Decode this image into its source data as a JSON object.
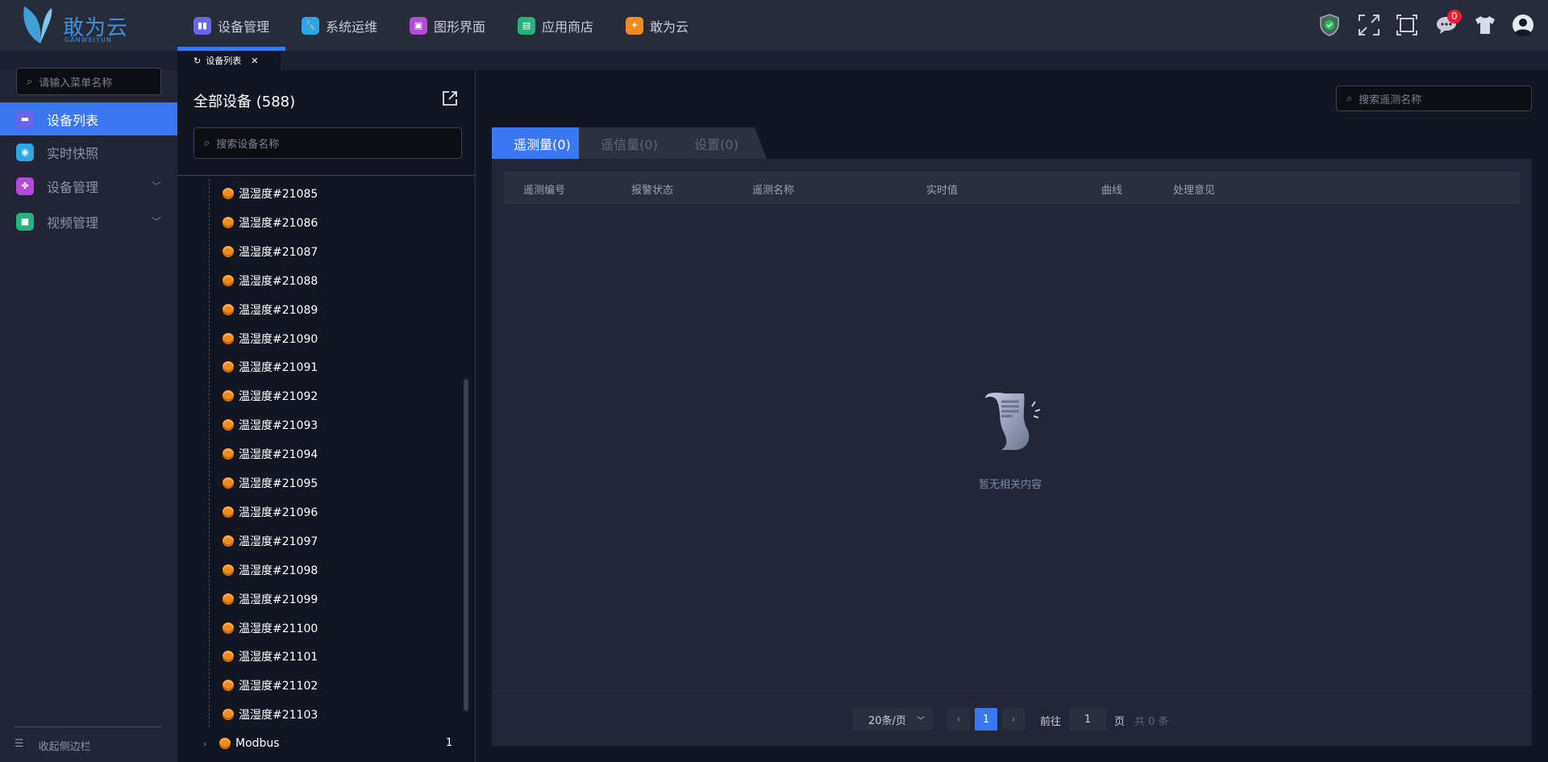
{
  "brand": {
    "name": "敢为云",
    "sub": "GANWEIYUN"
  },
  "nav": [
    {
      "label": "设备管理",
      "color": "#6a64e8",
      "active": true
    },
    {
      "label": "系统运维",
      "color": "#2ba7e6"
    },
    {
      "label": "图形界面",
      "color": "#b44ad8"
    },
    {
      "label": "应用商店",
      "color": "#26b27a"
    },
    {
      "label": "敢为云",
      "color": "#f08c1e"
    }
  ],
  "header": {
    "message_count": "0"
  },
  "page_tab": {
    "label": "设备列表"
  },
  "sidebar": {
    "search_placeholder": "请输入菜单名称",
    "items": [
      {
        "label": "设备列表",
        "color": "#6a64e8",
        "active": true
      },
      {
        "label": "实时快照",
        "color": "#2ba7e6"
      },
      {
        "label": "设备管理",
        "color": "#b44ad8",
        "expandable": true
      },
      {
        "label": "视频管理",
        "color": "#26b27a",
        "expandable": true
      }
    ],
    "collapse_label": "收起侧边栏"
  },
  "devices": {
    "title": "全部设备 (588)",
    "search_placeholder": "搜索设备名称",
    "items": [
      "温湿度#21085",
      "温湿度#21086",
      "温湿度#21087",
      "温湿度#21088",
      "温湿度#21089",
      "温湿度#21090",
      "温湿度#21091",
      "温湿度#21092",
      "温湿度#21093",
      "温湿度#21094",
      "温湿度#21095",
      "温湿度#21096",
      "温湿度#21097",
      "温湿度#21098",
      "温湿度#21099",
      "温湿度#21100",
      "温湿度#21101",
      "温湿度#21102",
      "温湿度#21103"
    ],
    "group": {
      "label": "Modbus",
      "count": "1"
    }
  },
  "main": {
    "search_placeholder": "搜索遥测名称",
    "tabs": [
      {
        "label": "遥测量(0)",
        "active": true
      },
      {
        "label": "遥信量(0)"
      },
      {
        "label": "设置(0)"
      }
    ],
    "columns": [
      "遥测编号",
      "报警状态",
      "遥测名称",
      "实时值",
      "曲线",
      "处理意见"
    ],
    "empty_text": "暂无相关内容",
    "pagination": {
      "page_size": "20条/页",
      "current_page": "1",
      "goto_label": "前往",
      "goto_value": "1",
      "page_unit": "页",
      "total": "共 0 条"
    }
  }
}
